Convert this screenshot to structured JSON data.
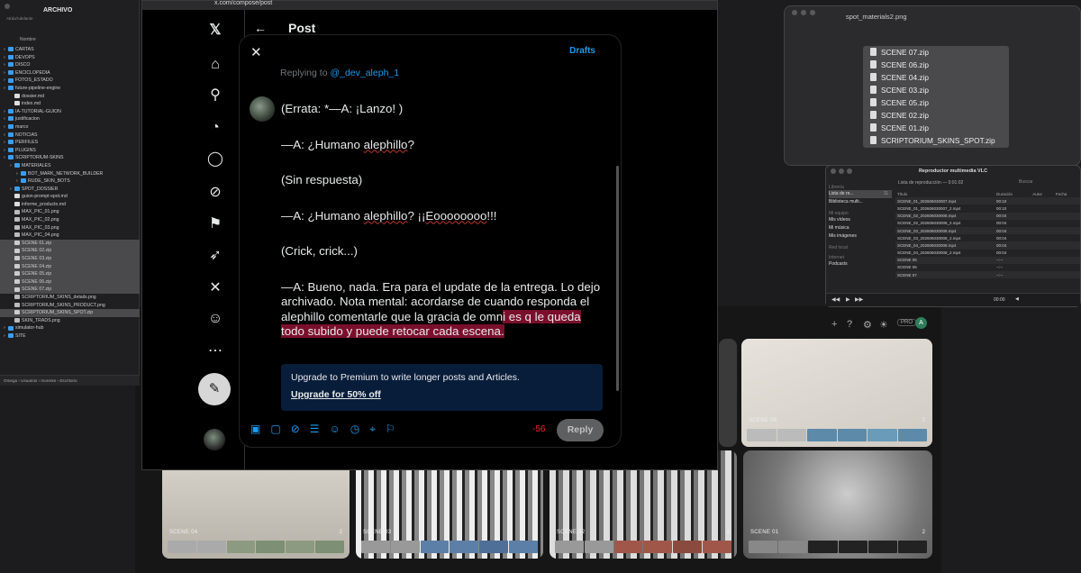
{
  "finder": {
    "title": "ARCHIVO",
    "subtitle": "Atrás/Adelante",
    "column_header": "Nombre",
    "items": [
      {
        "name": "CARTAS",
        "indent": 0,
        "kind": "folder",
        "selected": false
      },
      {
        "name": "DEVOPS",
        "indent": 0,
        "kind": "folder",
        "selected": false
      },
      {
        "name": "DISCO",
        "indent": 0,
        "kind": "folder",
        "selected": false
      },
      {
        "name": "ENCICLOPEDIA",
        "indent": 0,
        "kind": "folder",
        "selected": false
      },
      {
        "name": "FOTOS_ESTADO",
        "indent": 0,
        "kind": "folder",
        "selected": false
      },
      {
        "name": "future-pipeline-engine",
        "indent": 0,
        "kind": "folder",
        "selected": false
      },
      {
        "name": "dossier.md",
        "indent": 1,
        "kind": "file",
        "selected": false
      },
      {
        "name": "index.md",
        "indent": 1,
        "kind": "file",
        "selected": false
      },
      {
        "name": "IA-TUTORIAL-GUION",
        "indent": 0,
        "kind": "folder",
        "selected": false
      },
      {
        "name": "justificacion",
        "indent": 0,
        "kind": "folder",
        "selected": false
      },
      {
        "name": "marco",
        "indent": 0,
        "kind": "folder",
        "selected": false
      },
      {
        "name": "NOTICIAS",
        "indent": 0,
        "kind": "folder",
        "selected": false
      },
      {
        "name": "PERFILES",
        "indent": 0,
        "kind": "folder",
        "selected": false
      },
      {
        "name": "PLUGINS",
        "indent": 0,
        "kind": "folder",
        "selected": false
      },
      {
        "name": "SCRIPTORIUM-SKINS",
        "indent": 0,
        "kind": "folder",
        "selected": false
      },
      {
        "name": "MATERIALES",
        "indent": 1,
        "kind": "folder",
        "selected": false
      },
      {
        "name": "BOT_MARK_NETWORK_BUILDER",
        "indent": 2,
        "kind": "folder",
        "selected": false
      },
      {
        "name": "RUDE_SKIN_BOTS",
        "indent": 2,
        "kind": "folder",
        "selected": false
      },
      {
        "name": "SPOT_DOSSIER",
        "indent": 1,
        "kind": "folder",
        "selected": false
      },
      {
        "name": "guion-prompt-spot.md",
        "indent": 1,
        "kind": "file",
        "selected": false
      },
      {
        "name": "informe_producto.md",
        "indent": 1,
        "kind": "file",
        "selected": false
      },
      {
        "name": "MAX_PIC_01.png",
        "indent": 1,
        "kind": "image",
        "selected": false
      },
      {
        "name": "MAX_PIC_02.png",
        "indent": 1,
        "kind": "image",
        "selected": false
      },
      {
        "name": "MAX_PIC_03.png",
        "indent": 1,
        "kind": "image",
        "selected": false
      },
      {
        "name": "MAX_PIC_04.png",
        "indent": 1,
        "kind": "image",
        "selected": false
      },
      {
        "name": "SCENE 01.zip",
        "indent": 1,
        "kind": "zip",
        "selected": true
      },
      {
        "name": "SCENE 02.zip",
        "indent": 1,
        "kind": "zip",
        "selected": true
      },
      {
        "name": "SCENE 03.zip",
        "indent": 1,
        "kind": "zip",
        "selected": true
      },
      {
        "name": "SCENE 04.zip",
        "indent": 1,
        "kind": "zip",
        "selected": true
      },
      {
        "name": "SCENE 05.zip",
        "indent": 1,
        "kind": "zip",
        "selected": true
      },
      {
        "name": "SCENE 06.zip",
        "indent": 1,
        "kind": "zip",
        "selected": true
      },
      {
        "name": "SCENE 07.zip",
        "indent": 1,
        "kind": "zip",
        "selected": true
      },
      {
        "name": "SCRIPTORIUM_SKINS_details.png",
        "indent": 1,
        "kind": "image",
        "selected": false
      },
      {
        "name": "SCRIPTORIUM_SKINS_PRODUCT.png",
        "indent": 1,
        "kind": "image",
        "selected": false
      },
      {
        "name": "SCRIPTORIUM_SKINS_SPOT.zip",
        "indent": 1,
        "kind": "zip",
        "selected": true
      },
      {
        "name": "SKIN_TRADS.png",
        "indent": 1,
        "kind": "image",
        "selected": false
      },
      {
        "name": "simulator-hub",
        "indent": 0,
        "kind": "folder",
        "selected": false
      },
      {
        "name": "SITE",
        "indent": 0,
        "kind": "folder",
        "selected": false
      }
    ],
    "path": [
      "Omega",
      "Usuarios",
      "morente",
      "Escritorio"
    ]
  },
  "browser": {
    "url": "x.com/compose/post",
    "page_title": "Post"
  },
  "compose": {
    "drafts_label": "Drafts",
    "replying_prefix": "Replying to",
    "replying_handle": "@_dev_aleph_1",
    "paragraphs": [
      "(Errata: *—A: ¡Lanzo! )",
      "—A: ¿Humano alephillo?",
      "(Sin respuesta)",
      "—A: ¿Humano alephillo? ¡¡Eoooooooo!!!",
      "(Crick, crick...)"
    ],
    "last_paragraph_normal": "—A: Bueno, nada. Era para el update de la entrega. Lo dejo archivado. Nota mental: acordarse de cuando responda el alephillo comentarle que la gracia de omn",
    "last_paragraph_over": "i es q le queda todo subido y puede retocar cada escena.",
    "premium_text": "Upgrade to Premium to write longer posts and Articles.",
    "premium_link": "Upgrade for 50% off",
    "char_count": "-56",
    "reply_label": "Reply"
  },
  "preview": {
    "title": "spot_materials2.png",
    "files": [
      "SCENE 07.zip",
      "SCENE 06.zip",
      "SCENE 04.zip",
      "SCENE 03.zip",
      "SCENE 05.zip",
      "SCENE 02.zip",
      "SCENE 01.zip",
      "SCRIPTORIUM_SKINS_SPOT.zip"
    ]
  },
  "vlc": {
    "title": "Reproductor multimedia VLC",
    "library_label": "Librería",
    "sidebar_items": [
      {
        "label": "Lista de re...",
        "badge": "11",
        "selected": true
      },
      {
        "label": "Biblioteca multi...",
        "badge": "",
        "selected": false
      }
    ],
    "my_team_label": "Mi equipo",
    "my_team_items": [
      "Mis vídeos",
      "Mi música",
      "Mis imágenes"
    ],
    "local_network_label": "Red local",
    "internet_label": "Internet",
    "internet_items": [
      "Podcasts"
    ],
    "playlist_info": "Lista de reproducción — 0:01:02",
    "search_placeholder": "Buscar",
    "columns": [
      "Título",
      "Duración",
      "Autor",
      "Fecha"
    ],
    "rows": [
      {
        "title": "SCENE_01_202606030007.mp4",
        "duration": "00:10"
      },
      {
        "title": "SCENE_01_202606030007_2.mp4",
        "duration": "00:10"
      },
      {
        "title": "SCENE_02_202606030008.mp4",
        "duration": "00:04"
      },
      {
        "title": "SCENE_02_202606030008_2.mp4",
        "duration": "00:04"
      },
      {
        "title": "SCENE_03_202606030008.mp4",
        "duration": "00:04"
      },
      {
        "title": "SCENE_03_202606030008_2.mp4",
        "duration": "00:04"
      },
      {
        "title": "SCENE_04_202606030008.mp4",
        "duration": "00:04"
      },
      {
        "title": "SCENE_04_202606030008_2.mp4",
        "duration": "00:04"
      },
      {
        "title": "SCENE 05",
        "duration": "--:--"
      },
      {
        "title": "SCENE 06",
        "duration": "--:--"
      },
      {
        "title": "SCENE 07",
        "duration": "--:--"
      }
    ],
    "time": "00:00"
  },
  "gallery": {
    "pro_label": "PRO",
    "user_initial": "A",
    "cards": [
      {
        "label": "SCENE 05",
        "count": "2"
      },
      {
        "label": "SCENE 04",
        "count": "2"
      },
      {
        "label": "SCENE 03",
        "count": "2"
      },
      {
        "label": "SCENE 02",
        "count": "2"
      },
      {
        "label": "SCENE 01",
        "count": "2"
      }
    ]
  },
  "colors": {
    "accent": "#1d9bf0",
    "counter_over": "#f4212e",
    "over_highlight": "#7a0f2c",
    "premium_bg": "#081d3a"
  }
}
